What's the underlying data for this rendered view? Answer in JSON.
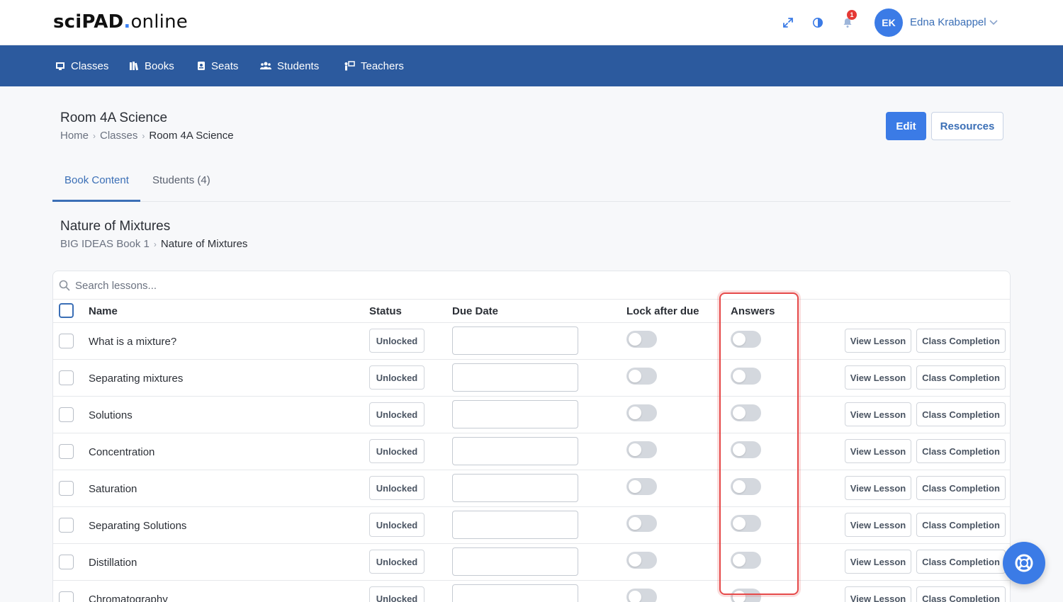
{
  "brand": {
    "part1": "sciPAD",
    "dot": ".",
    "part2": "online"
  },
  "colors": {
    "accent": "#3b7be6",
    "nav": "#2c5a9e",
    "highlight": "#e64a4a",
    "badge": "#e53935"
  },
  "header": {
    "icons": [
      "expand-icon",
      "contrast-icon",
      "bell-icon",
      "chevron-down-icon"
    ],
    "notification_count": "1",
    "user": {
      "initials": "EK",
      "name": "Edna Krabappel"
    }
  },
  "nav": [
    {
      "label": "Classes",
      "icon": "classes-icon"
    },
    {
      "label": "Books",
      "icon": "books-icon"
    },
    {
      "label": "Seats",
      "icon": "seats-icon"
    },
    {
      "label": "Students",
      "icon": "students-icon"
    },
    {
      "label": "Teachers",
      "icon": "teachers-icon"
    }
  ],
  "page": {
    "title": "Room 4A Science",
    "breadcrumb": [
      "Home",
      "Classes",
      "Room 4A Science"
    ],
    "edit_label": "Edit",
    "resources_label": "Resources"
  },
  "tabs": [
    {
      "label": "Book Content",
      "active": true
    },
    {
      "label": "Students (4)",
      "active": false
    }
  ],
  "section": {
    "title": "Nature of Mixtures",
    "breadcrumb": [
      "BIG IDEAS Book 1",
      "Nature of Mixtures"
    ]
  },
  "search": {
    "placeholder": "Search lessons...",
    "value": ""
  },
  "table": {
    "columns": {
      "name": "Name",
      "status": "Status",
      "due": "Due Date",
      "lock": "Lock after due",
      "answers": "Answers"
    },
    "view_label": "View Lesson",
    "completion_label": "Class Completion",
    "rows": [
      {
        "name": "What is a mixture?",
        "status": "Unlocked",
        "due": "",
        "lock": false,
        "answers": false
      },
      {
        "name": "Separating mixtures",
        "status": "Unlocked",
        "due": "",
        "lock": false,
        "answers": false
      },
      {
        "name": "Solutions",
        "status": "Unlocked",
        "due": "",
        "lock": false,
        "answers": false
      },
      {
        "name": "Concentration",
        "status": "Unlocked",
        "due": "",
        "lock": false,
        "answers": false
      },
      {
        "name": "Saturation",
        "status": "Unlocked",
        "due": "",
        "lock": false,
        "answers": false
      },
      {
        "name": "Separating Solutions",
        "status": "Unlocked",
        "due": "",
        "lock": false,
        "answers": false
      },
      {
        "name": "Distillation",
        "status": "Unlocked",
        "due": "",
        "lock": false,
        "answers": false
      },
      {
        "name": "Chromatography",
        "status": "Unlocked",
        "due": "",
        "lock": false,
        "answers": false
      }
    ]
  }
}
